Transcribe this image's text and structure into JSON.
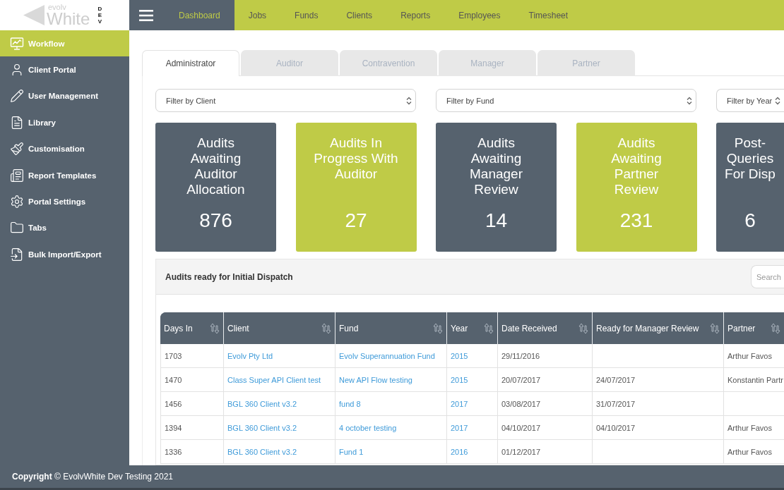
{
  "logo": {
    "small_text": "evolv",
    "text": "White",
    "badge": "DEV"
  },
  "top_nav": [
    {
      "label": "Dashboard",
      "selected": true
    },
    {
      "label": "Jobs",
      "selected": false
    },
    {
      "label": "Funds",
      "selected": false
    },
    {
      "label": "Clients",
      "selected": false
    },
    {
      "label": "Reports",
      "selected": false
    },
    {
      "label": "Employees",
      "selected": false
    },
    {
      "label": "Timesheet",
      "selected": false
    }
  ],
  "sidebar": {
    "items": [
      {
        "label": "Workflow",
        "selected": true
      },
      {
        "label": "Client Portal",
        "selected": false
      },
      {
        "label": "User Management",
        "selected": false
      },
      {
        "label": "Library",
        "selected": false
      },
      {
        "label": "Customisation",
        "selected": false
      },
      {
        "label": "Report Templates",
        "selected": false
      },
      {
        "label": "Portal Settings",
        "selected": false
      },
      {
        "label": "Tabs",
        "selected": false
      },
      {
        "label": "Bulk Import/Export",
        "selected": false
      }
    ]
  },
  "tabs": [
    {
      "label": "Administrator",
      "selected": true
    },
    {
      "label": "Auditor",
      "selected": false
    },
    {
      "label": "Contravention",
      "selected": false
    },
    {
      "label": "Manager",
      "selected": false
    },
    {
      "label": "Partner",
      "selected": false
    }
  ],
  "filters": [
    {
      "value": "Filter by Client"
    },
    {
      "value": "Filter by Fund"
    },
    {
      "value": "Filter by Year"
    }
  ],
  "cards": [
    {
      "title": "Audits Awaiting Auditor Allocation",
      "count": "876",
      "color": "#56626e"
    },
    {
      "title": "Audits In Progress With Auditor",
      "count": "27",
      "color": "#bfcb47"
    },
    {
      "title": "Audits Awaiting Manager Review",
      "count": "14",
      "color": "#56626e"
    },
    {
      "title": "Audits Awaiting Partner Review",
      "count": "231",
      "color": "#bfcb47"
    },
    {
      "title": "Post-Queries For Disp",
      "count": "6",
      "color": "#56626e"
    }
  ],
  "table": {
    "title": "Audits ready for Initial Dispatch",
    "search": {
      "placeholder": "Search"
    },
    "columns": [
      {
        "label": "Days In",
        "kind": "text"
      },
      {
        "label": "Client",
        "kind": "link"
      },
      {
        "label": "Fund",
        "kind": "link"
      },
      {
        "label": "Year",
        "kind": "link"
      },
      {
        "label": "Date Received",
        "kind": "text"
      },
      {
        "label": "Ready for Manager Review",
        "kind": "text"
      },
      {
        "label": "Partner",
        "kind": "text"
      }
    ],
    "rows": [
      [
        "1703",
        "Evolv Pty Ltd",
        "Evolv Superannuation Fund",
        "2015",
        "29/11/2016",
        null,
        "Arthur Favos"
      ],
      [
        "1470",
        "Class Super API Client test",
        "New API Flow testing",
        "2015",
        "20/07/2017",
        "24/07/2017",
        "Konstantin Partr"
      ],
      [
        "1456",
        "BGL 360 Client v3.2",
        "fund 8",
        "2017",
        "03/08/2017",
        "31/07/2017",
        null
      ],
      [
        "1394",
        "BGL 360 Client v3.2",
        "4 october testing",
        "2017",
        "04/10/2017",
        "04/10/2017",
        "Arthur Favos"
      ],
      [
        "1336",
        "BGL 360 Client v3.2",
        "Fund 1",
        "2016",
        "01/12/2017",
        null,
        "Arthur Favos"
      ]
    ]
  },
  "footer": {
    "text": "**Copyright** © EvolvWhite Dev Testing 2021"
  }
}
